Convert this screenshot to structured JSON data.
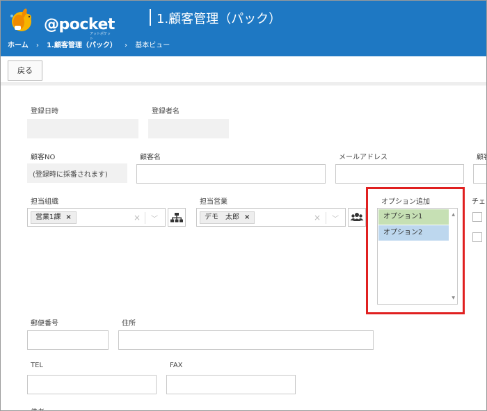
{
  "app": {
    "logo_text": "@pocket",
    "logo_subtext": "アットポケット",
    "page_title": "1.顧客管理（パック）"
  },
  "breadcrumb": {
    "home": "ホーム",
    "section": "1.顧客管理（パック）",
    "current": "基本ビュー",
    "separator": "›"
  },
  "toolbar": {
    "back_label": "戻る"
  },
  "form": {
    "reg_date_label": "登録日時",
    "reg_user_label": "登録者名",
    "customer_no_label": "顧客NO",
    "customer_no_value": "(登録時に採番されます)",
    "customer_name_label": "顧客名",
    "email_label": "メールアドレス",
    "cut_label_right": "顧客",
    "org_label": "担当組織",
    "org_tag": "営業1課",
    "sales_label": "担当営業",
    "sales_tag": "デモ　太郎",
    "option_label": "オプション追加",
    "options": [
      "オプション1",
      "オプション2"
    ],
    "check_label": "チェ",
    "postal_label": "郵便番号",
    "address_label": "住所",
    "tel_label": "TEL",
    "fax_label": "FAX",
    "remarks_label": "備考"
  },
  "colors": {
    "header_bg": "#1e78c3",
    "option1_bg": "#c6e0b4",
    "option2_bg": "#bdd7ee",
    "highlight": "#e02020"
  }
}
